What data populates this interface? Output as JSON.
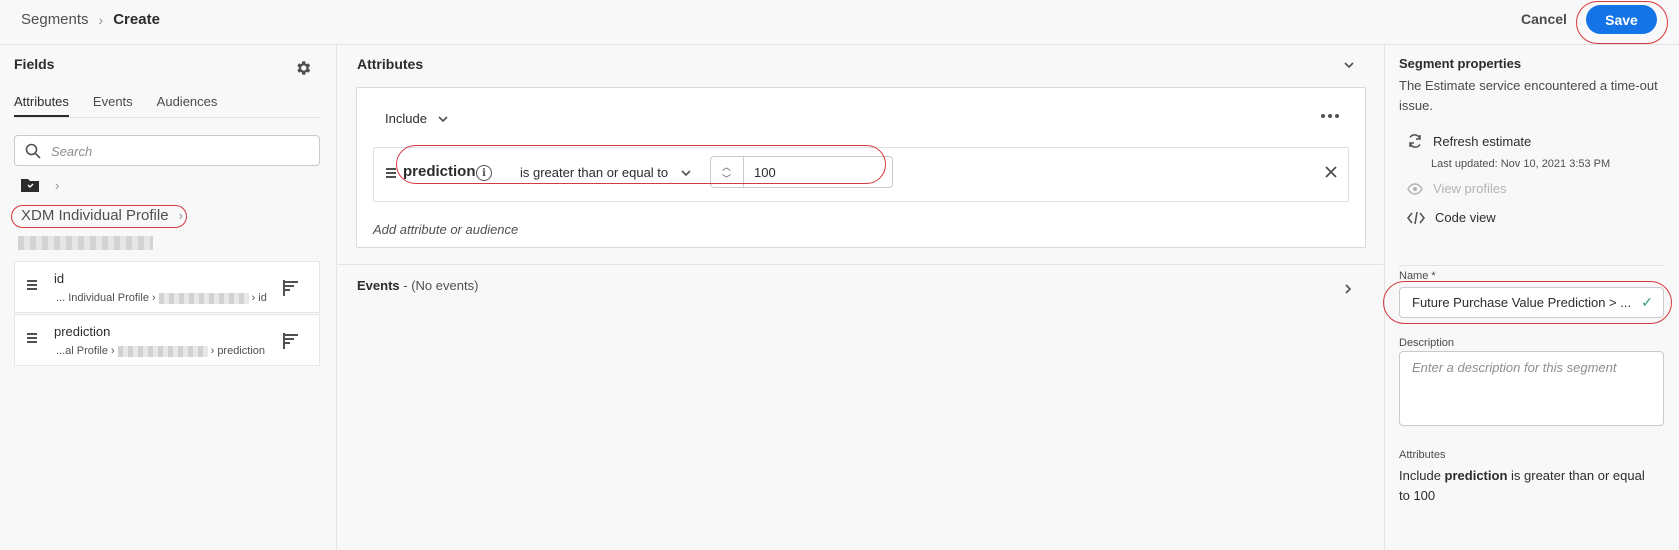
{
  "header": {
    "breadcrumb_parent": "Segments",
    "breadcrumb_current": "Create",
    "cancel_label": "Cancel",
    "save_label": "Save"
  },
  "fields_panel": {
    "title": "Fields",
    "tabs": [
      {
        "label": "Attributes",
        "active": true
      },
      {
        "label": "Events",
        "active": false
      },
      {
        "label": "Audiences",
        "active": false
      }
    ],
    "search_placeholder": "Search",
    "schema_label": "XDM Individual Profile",
    "items": [
      {
        "name": "id",
        "path_prefix": "... Individual Profile",
        "path_suffix": "id"
      },
      {
        "name": "prediction",
        "path_prefix": "...al Profile",
        "path_suffix": "prediction"
      }
    ]
  },
  "canvas": {
    "attributes_title": "Attributes",
    "include_label": "Include",
    "rule": {
      "attribute": "prediction",
      "operator": "is greater than or equal to",
      "value": "100"
    },
    "add_placeholder": "Add attribute or audience",
    "events_title": "Events",
    "events_note": "- (No events)"
  },
  "properties": {
    "title": "Segment properties",
    "message": "The Estimate service encountered a time-out issue.",
    "refresh_label": "Refresh estimate",
    "last_updated": "Last updated: Nov 10, 2021 3:53 PM",
    "view_profiles_label": "View profiles",
    "code_view_label": "Code view",
    "name_label": "Name *",
    "name_value": "Future Purchase Value Prediction > ...",
    "description_label": "Description",
    "description_placeholder": "Enter a description for this segment",
    "attributes_label": "Attributes",
    "summary_include": "Include",
    "summary_attr": "prediction",
    "summary_rest": "is greater than or equal to 100"
  },
  "colors": {
    "accent": "#1473e6",
    "highlight_ring": "#d7373f",
    "valid_check": "#2d9d78"
  }
}
